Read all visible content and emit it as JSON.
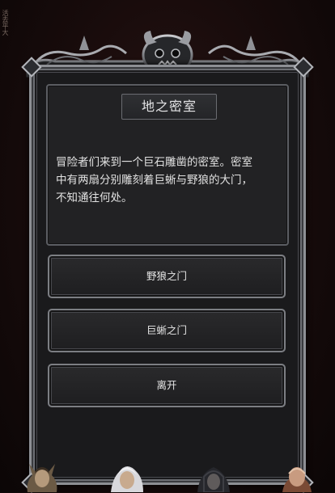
{
  "edge": {
    "glyphs": "活去平大"
  },
  "dialog": {
    "title": "地之密室",
    "lines": [
      "冒险者们来到一个巨石雕凿的密室。密室",
      "中有两扇分别雕刻着巨蜥与野狼的大门，",
      "不知通往何处。"
    ]
  },
  "choices": [
    {
      "label": "野狼之门"
    },
    {
      "label": "巨蜥之门"
    },
    {
      "label": "离开"
    }
  ],
  "portraits": [
    {
      "name": "elf-warrior-portrait"
    },
    {
      "name": "white-haired-hero-portrait"
    },
    {
      "name": "hooded-rogue-portrait"
    },
    {
      "name": "bald-monk-portrait"
    }
  ],
  "colors": {
    "frame": "#8d8f94",
    "panel": "#222224",
    "text": "#e2e2e2",
    "background": "#170b0b"
  }
}
